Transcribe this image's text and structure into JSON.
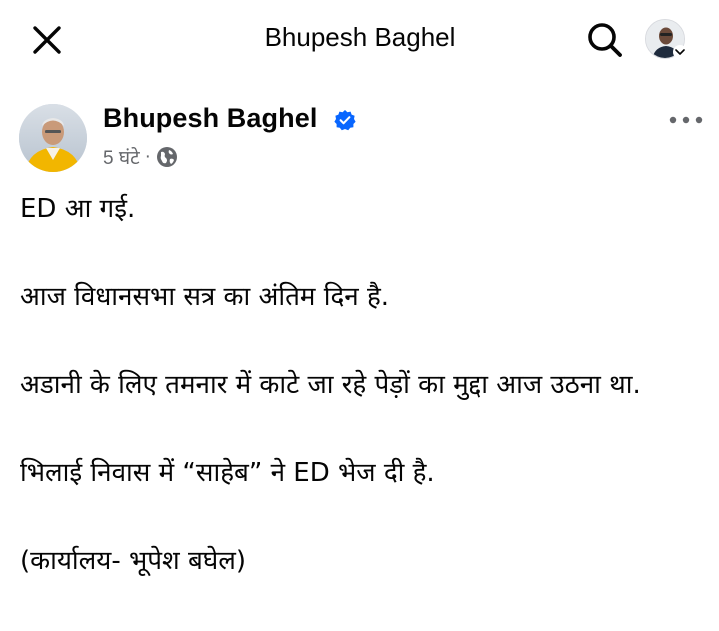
{
  "header": {
    "title": "Bhupesh Baghel",
    "close_icon": "close-icon",
    "search_icon": "search-icon",
    "profile_icon": "profile-avatar"
  },
  "post": {
    "author": "Bhupesh Baghel",
    "verified": true,
    "time": "5 घंटे",
    "separator": "·",
    "audience_icon": "globe-icon",
    "paragraphs": [
      "ED आ गई.",
      "आज विधानसभा सत्र का अंतिम दिन है.",
      "अडानी के लिए तमनार में काटे जा रहे पेड़ों का मुद्दा आज उठना था.",
      "भिलाई निवास में “साहेब” ने ED भेज दी है.",
      "(कार्यालय- भूपेश बघेल)"
    ]
  },
  "colors": {
    "verified": "#0866ff",
    "meta": "#65676b",
    "text": "#050505"
  }
}
